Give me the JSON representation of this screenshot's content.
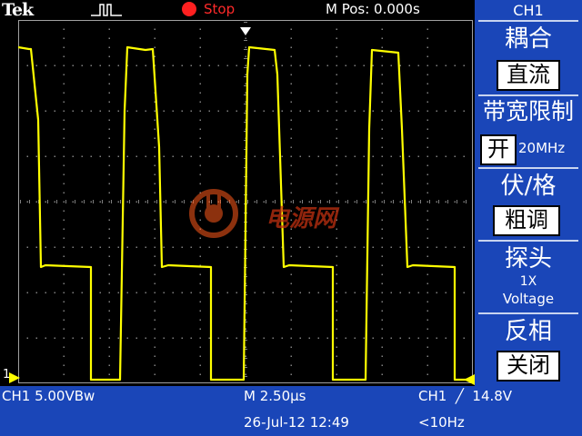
{
  "header": {
    "brand": "Tek",
    "trigger_icon": "pulse-trigger-icon",
    "acq_state": "Stop",
    "horizontal_position": "M Pos: 0.000s"
  },
  "menu": {
    "channel_title": "CH1",
    "coupling_label": "耦合",
    "coupling_value": "直流",
    "bandwidth_label": "带宽限制",
    "bandwidth_value": "开",
    "bandwidth_freq": "20MHz",
    "volts_div_label": "伏/格",
    "volts_div_value": "粗调",
    "probe_label": "探头",
    "probe_ratio": "1X",
    "probe_type": "Voltage",
    "invert_label": "反相",
    "invert_value": "关闭"
  },
  "status": {
    "ch1_scale": "CH1  5.00VBw",
    "timebase": "M 2.50µs",
    "trigger_info": "CH1  ╱  14.8V",
    "date_time": "26-Jul-12 12:49",
    "frequency": "<10Hz"
  },
  "markers": {
    "ch1_ground": "1"
  },
  "watermark": {
    "text": "电源网"
  },
  "colors": {
    "trace": "#ffff00",
    "menu_bg": "#1a46b8",
    "stop": "#ff2020",
    "grid": "#808080"
  }
}
